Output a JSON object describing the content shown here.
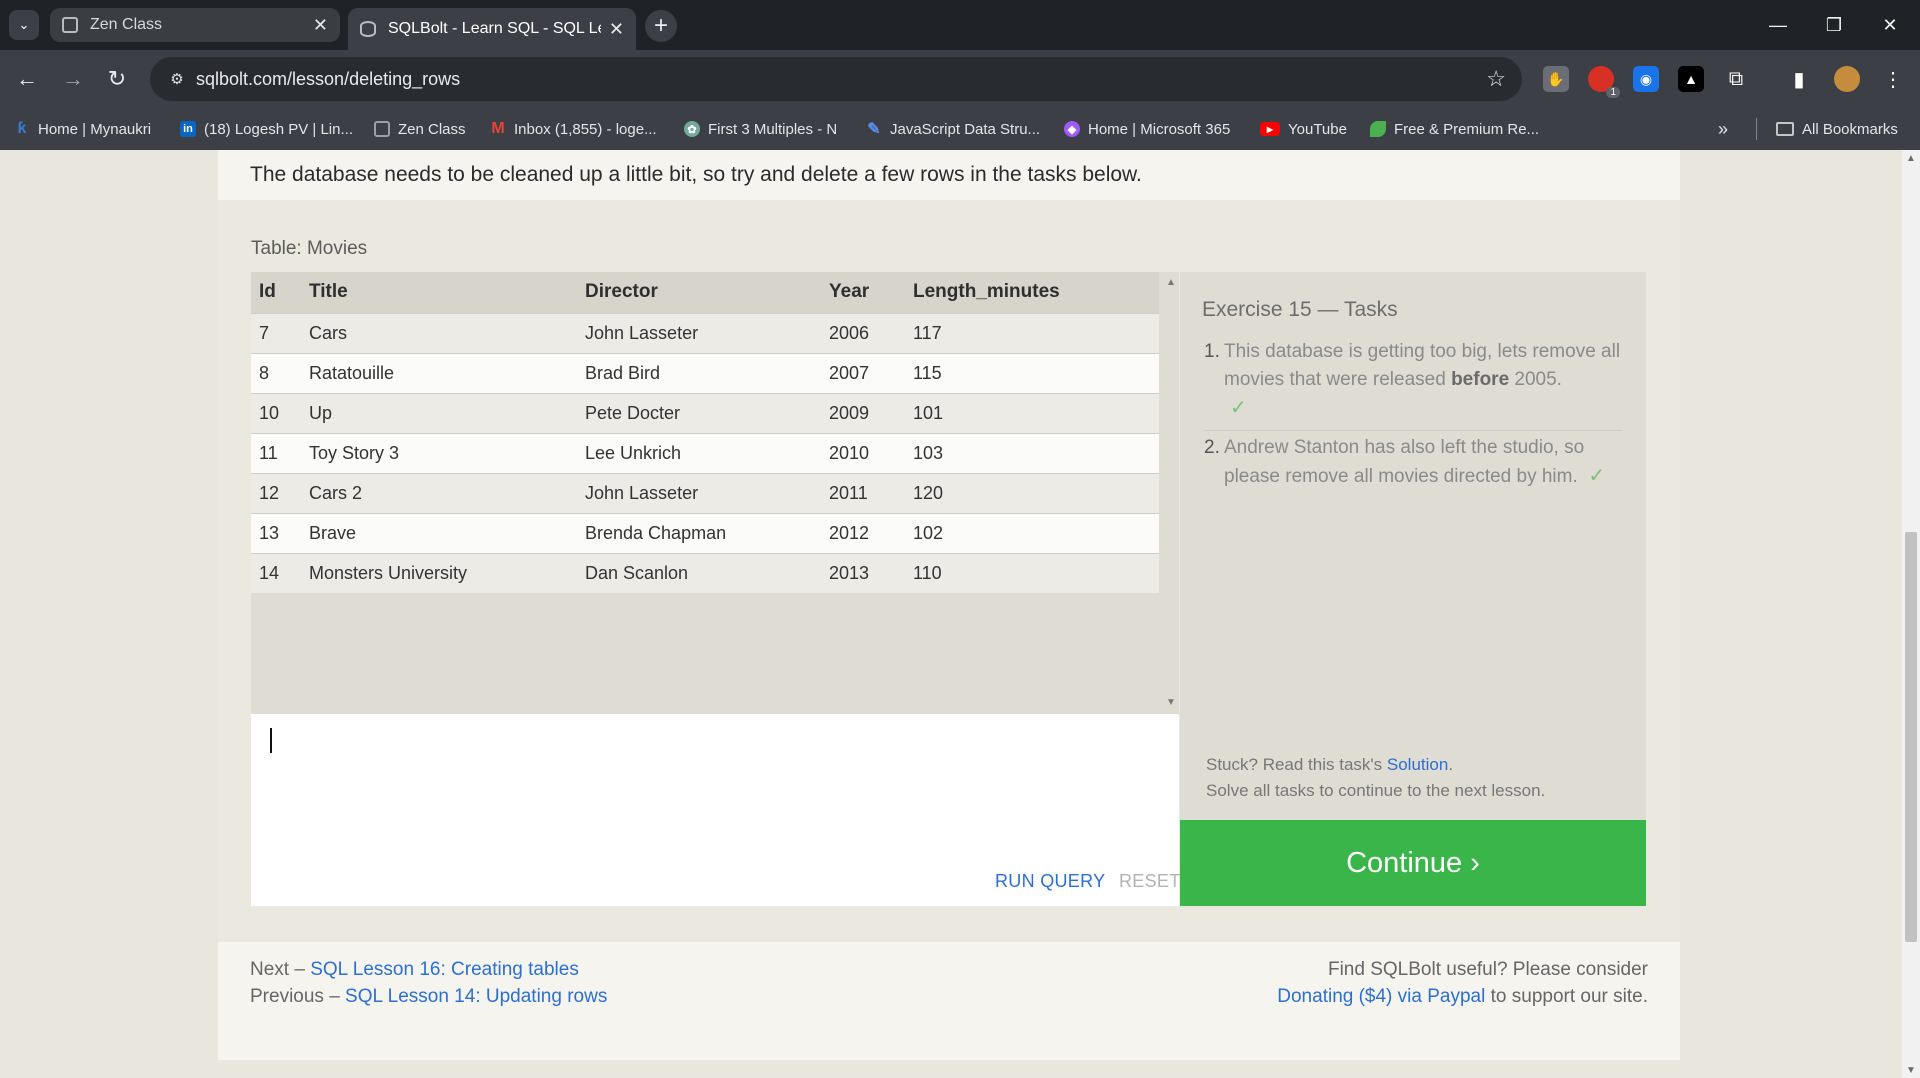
{
  "browser": {
    "tabs": [
      {
        "title": "Zen Class",
        "active": false
      },
      {
        "title": "SQLBolt - Learn SQL - SQL Less",
        "active": true
      }
    ],
    "url": "sqlbolt.com/lesson/deleting_rows",
    "bookmarks": [
      {
        "label": "Home | Mynaukri",
        "icon": "mynaukri-icon",
        "color": "#3a7bd5"
      },
      {
        "label": "(18) Logesh PV | Lin...",
        "icon": "linkedin-icon",
        "color": "#0a66c2"
      },
      {
        "label": "Zen Class",
        "icon": "zen-class-icon",
        "color": "#9aa0a6"
      },
      {
        "label": "Inbox (1,855) - loge...",
        "icon": "gmail-icon",
        "color": "#ea4335"
      },
      {
        "label": "First 3 Multiples - N",
        "icon": "chatgpt-icon",
        "color": "#74aa9c"
      },
      {
        "label": "JavaScript Data Stru...",
        "icon": "freecodecamp-icon",
        "color": "#5b8def"
      },
      {
        "label": "Home | Microsoft 365",
        "icon": "microsoft365-icon",
        "color": "#a259ff"
      },
      {
        "label": "YouTube",
        "icon": "youtube-icon",
        "color": "#ff0000"
      },
      {
        "label": "Free & Premium Re...",
        "icon": "leaf-icon",
        "color": "#4caf50"
      }
    ],
    "more_bookmarks": "»",
    "all_bookmarks": "All Bookmarks",
    "extension_badge": "1"
  },
  "page": {
    "intro": "The database needs to be cleaned up a little bit, so try and delete a few rows in the tasks below.",
    "table_caption": "Table: Movies",
    "columns": [
      "Id",
      "Title",
      "Director",
      "Year",
      "Length_minutes"
    ],
    "rows": [
      [
        "7",
        "Cars",
        "John Lasseter",
        "2006",
        "117"
      ],
      [
        "8",
        "Ratatouille",
        "Brad Bird",
        "2007",
        "115"
      ],
      [
        "10",
        "Up",
        "Pete Docter",
        "2009",
        "101"
      ],
      [
        "11",
        "Toy Story 3",
        "Lee Unkrich",
        "2010",
        "103"
      ],
      [
        "12",
        "Cars 2",
        "John Lasseter",
        "2011",
        "120"
      ],
      [
        "13",
        "Brave",
        "Brenda Chapman",
        "2012",
        "102"
      ],
      [
        "14",
        "Monsters University",
        "Dan Scanlon",
        "2013",
        "110"
      ]
    ],
    "query_text": "",
    "run_label": "RUN QUERY",
    "reset_label": "RESET",
    "tasks_title": "Exercise 15 — Tasks",
    "task1": {
      "num": "1.",
      "pre": "This database is getting too big, lets remove all movies that were released ",
      "bold": "before",
      "post": " 2005.",
      "check": "✓"
    },
    "task2": {
      "num": "2.",
      "text": "Andrew Stanton has also left the studio, so please remove all movies directed by him.",
      "check": "✓"
    },
    "stuck_pre": "Stuck? Read this task's ",
    "stuck_link": "Solution",
    "stuck_post": ".",
    "solve_all": "Solve all tasks to continue to the next lesson.",
    "continue_label": "Continue ›",
    "next_prefix": "Next – ",
    "next_link": "SQL Lesson 16: Creating tables",
    "prev_prefix": "Previous – ",
    "prev_link": "SQL Lesson 14: Updating rows",
    "donate_line1": "Find SQLBolt useful? Please consider",
    "donate_link": "Donating ($4) via Paypal",
    "donate_post": " to support our site."
  }
}
